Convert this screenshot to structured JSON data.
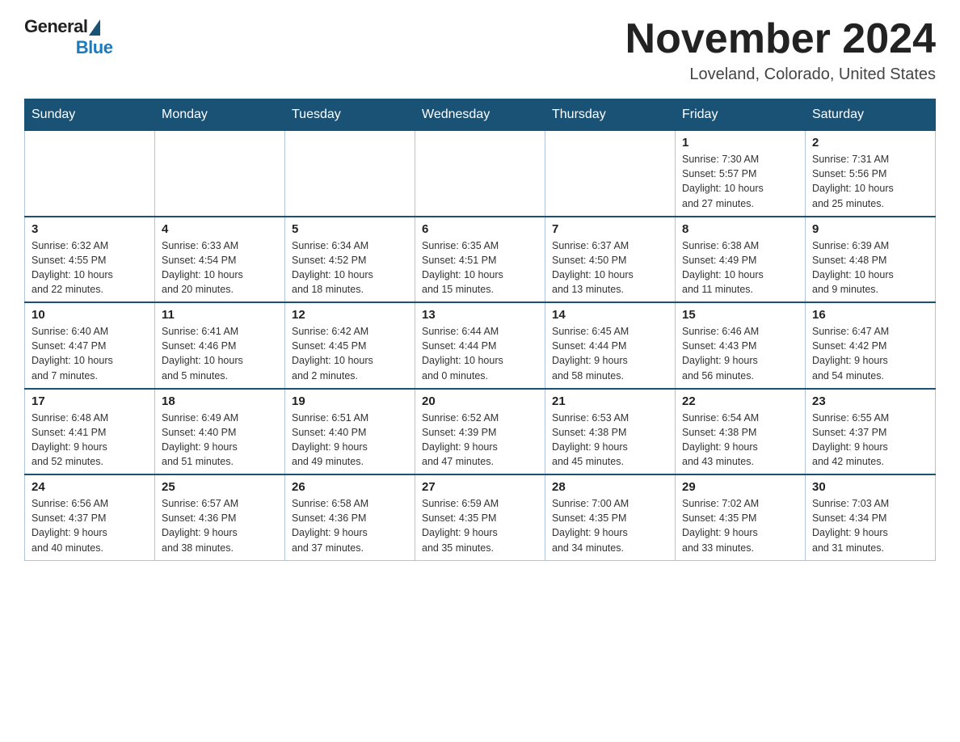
{
  "header": {
    "logo_general": "General",
    "logo_blue": "Blue",
    "month_title": "November 2024",
    "location": "Loveland, Colorado, United States"
  },
  "weekdays": [
    "Sunday",
    "Monday",
    "Tuesday",
    "Wednesday",
    "Thursday",
    "Friday",
    "Saturday"
  ],
  "weeks": [
    [
      {
        "day": "",
        "info": ""
      },
      {
        "day": "",
        "info": ""
      },
      {
        "day": "",
        "info": ""
      },
      {
        "day": "",
        "info": ""
      },
      {
        "day": "",
        "info": ""
      },
      {
        "day": "1",
        "info": "Sunrise: 7:30 AM\nSunset: 5:57 PM\nDaylight: 10 hours\nand 27 minutes."
      },
      {
        "day": "2",
        "info": "Sunrise: 7:31 AM\nSunset: 5:56 PM\nDaylight: 10 hours\nand 25 minutes."
      }
    ],
    [
      {
        "day": "3",
        "info": "Sunrise: 6:32 AM\nSunset: 4:55 PM\nDaylight: 10 hours\nand 22 minutes."
      },
      {
        "day": "4",
        "info": "Sunrise: 6:33 AM\nSunset: 4:54 PM\nDaylight: 10 hours\nand 20 minutes."
      },
      {
        "day": "5",
        "info": "Sunrise: 6:34 AM\nSunset: 4:52 PM\nDaylight: 10 hours\nand 18 minutes."
      },
      {
        "day": "6",
        "info": "Sunrise: 6:35 AM\nSunset: 4:51 PM\nDaylight: 10 hours\nand 15 minutes."
      },
      {
        "day": "7",
        "info": "Sunrise: 6:37 AM\nSunset: 4:50 PM\nDaylight: 10 hours\nand 13 minutes."
      },
      {
        "day": "8",
        "info": "Sunrise: 6:38 AM\nSunset: 4:49 PM\nDaylight: 10 hours\nand 11 minutes."
      },
      {
        "day": "9",
        "info": "Sunrise: 6:39 AM\nSunset: 4:48 PM\nDaylight: 10 hours\nand 9 minutes."
      }
    ],
    [
      {
        "day": "10",
        "info": "Sunrise: 6:40 AM\nSunset: 4:47 PM\nDaylight: 10 hours\nand 7 minutes."
      },
      {
        "day": "11",
        "info": "Sunrise: 6:41 AM\nSunset: 4:46 PM\nDaylight: 10 hours\nand 5 minutes."
      },
      {
        "day": "12",
        "info": "Sunrise: 6:42 AM\nSunset: 4:45 PM\nDaylight: 10 hours\nand 2 minutes."
      },
      {
        "day": "13",
        "info": "Sunrise: 6:44 AM\nSunset: 4:44 PM\nDaylight: 10 hours\nand 0 minutes."
      },
      {
        "day": "14",
        "info": "Sunrise: 6:45 AM\nSunset: 4:44 PM\nDaylight: 9 hours\nand 58 minutes."
      },
      {
        "day": "15",
        "info": "Sunrise: 6:46 AM\nSunset: 4:43 PM\nDaylight: 9 hours\nand 56 minutes."
      },
      {
        "day": "16",
        "info": "Sunrise: 6:47 AM\nSunset: 4:42 PM\nDaylight: 9 hours\nand 54 minutes."
      }
    ],
    [
      {
        "day": "17",
        "info": "Sunrise: 6:48 AM\nSunset: 4:41 PM\nDaylight: 9 hours\nand 52 minutes."
      },
      {
        "day": "18",
        "info": "Sunrise: 6:49 AM\nSunset: 4:40 PM\nDaylight: 9 hours\nand 51 minutes."
      },
      {
        "day": "19",
        "info": "Sunrise: 6:51 AM\nSunset: 4:40 PM\nDaylight: 9 hours\nand 49 minutes."
      },
      {
        "day": "20",
        "info": "Sunrise: 6:52 AM\nSunset: 4:39 PM\nDaylight: 9 hours\nand 47 minutes."
      },
      {
        "day": "21",
        "info": "Sunrise: 6:53 AM\nSunset: 4:38 PM\nDaylight: 9 hours\nand 45 minutes."
      },
      {
        "day": "22",
        "info": "Sunrise: 6:54 AM\nSunset: 4:38 PM\nDaylight: 9 hours\nand 43 minutes."
      },
      {
        "day": "23",
        "info": "Sunrise: 6:55 AM\nSunset: 4:37 PM\nDaylight: 9 hours\nand 42 minutes."
      }
    ],
    [
      {
        "day": "24",
        "info": "Sunrise: 6:56 AM\nSunset: 4:37 PM\nDaylight: 9 hours\nand 40 minutes."
      },
      {
        "day": "25",
        "info": "Sunrise: 6:57 AM\nSunset: 4:36 PM\nDaylight: 9 hours\nand 38 minutes."
      },
      {
        "day": "26",
        "info": "Sunrise: 6:58 AM\nSunset: 4:36 PM\nDaylight: 9 hours\nand 37 minutes."
      },
      {
        "day": "27",
        "info": "Sunrise: 6:59 AM\nSunset: 4:35 PM\nDaylight: 9 hours\nand 35 minutes."
      },
      {
        "day": "28",
        "info": "Sunrise: 7:00 AM\nSunset: 4:35 PM\nDaylight: 9 hours\nand 34 minutes."
      },
      {
        "day": "29",
        "info": "Sunrise: 7:02 AM\nSunset: 4:35 PM\nDaylight: 9 hours\nand 33 minutes."
      },
      {
        "day": "30",
        "info": "Sunrise: 7:03 AM\nSunset: 4:34 PM\nDaylight: 9 hours\nand 31 minutes."
      }
    ]
  ]
}
